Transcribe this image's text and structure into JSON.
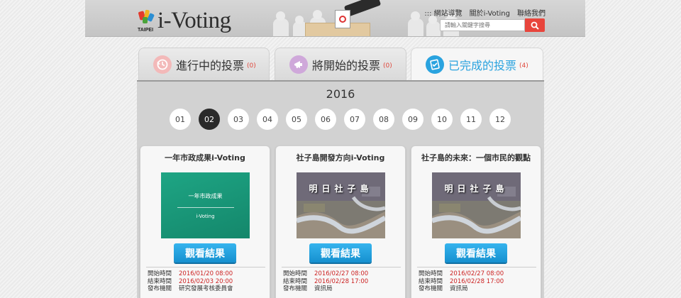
{
  "header": {
    "logo_city": "TAIPEI",
    "logo_text": "i-Voting",
    "nav": [
      "::: 網站導覽",
      "關於i-Voting",
      "聯絡我們"
    ],
    "search_placeholder": "請輸入關鍵字搜尋",
    "search_icon": "search-icon"
  },
  "tabs_dots": ":::",
  "tabs": [
    {
      "label": "進行中的投票",
      "count": "(0)",
      "icon": "clock-history-icon",
      "icon_color": "#f0a9a9"
    },
    {
      "label": "將開始的投票",
      "count": "(0)",
      "icon": "megaphone-icon",
      "icon_color": "#c9a6d6"
    },
    {
      "label": "已完成的投票",
      "count": "(4)",
      "icon": "finished-ballot-icon",
      "icon_color": "#2aa3df"
    }
  ],
  "year": "2016",
  "months": [
    "01",
    "02",
    "03",
    "04",
    "05",
    "06",
    "07",
    "08",
    "09",
    "10",
    "11",
    "12"
  ],
  "selected_month": "02",
  "cards": [
    {
      "title": "一年市政成果i-Voting",
      "thumb_text_1": "一年市政成果",
      "thumb_text_2": "i-Voting",
      "button": "觀看結果",
      "start_label": "開始時間",
      "start": "2016/01/20 08:00",
      "end_label": "結束時間",
      "end": "2016/02/03 20:00",
      "org_label": "發布機關",
      "org": "研究發展考核委員會"
    },
    {
      "title": "社子島開發方向i-Voting",
      "thumb_overlay": "明日社子島",
      "button": "觀看結果",
      "start_label": "開始時間",
      "start": "2016/02/27 08:00",
      "end_label": "結束時間",
      "end": "2016/02/28 17:00",
      "org_label": "發布機關",
      "org": "資訊局"
    },
    {
      "title": "社子島的未來：一個市民的觀點",
      "thumb_overlay": "明日社子島",
      "button": "觀看結果",
      "start_label": "開始時間",
      "start": "2016/02/27 08:00",
      "end_label": "結束時間",
      "end": "2016/02/28 17:00",
      "org_label": "發布機關",
      "org": "資訊局"
    }
  ],
  "colors": {
    "accent_blue": "#2aa3df",
    "count_red": "#e0463a",
    "date_red": "#c22222",
    "search_red": "#e8453c",
    "button_blue": "#1590cf"
  }
}
